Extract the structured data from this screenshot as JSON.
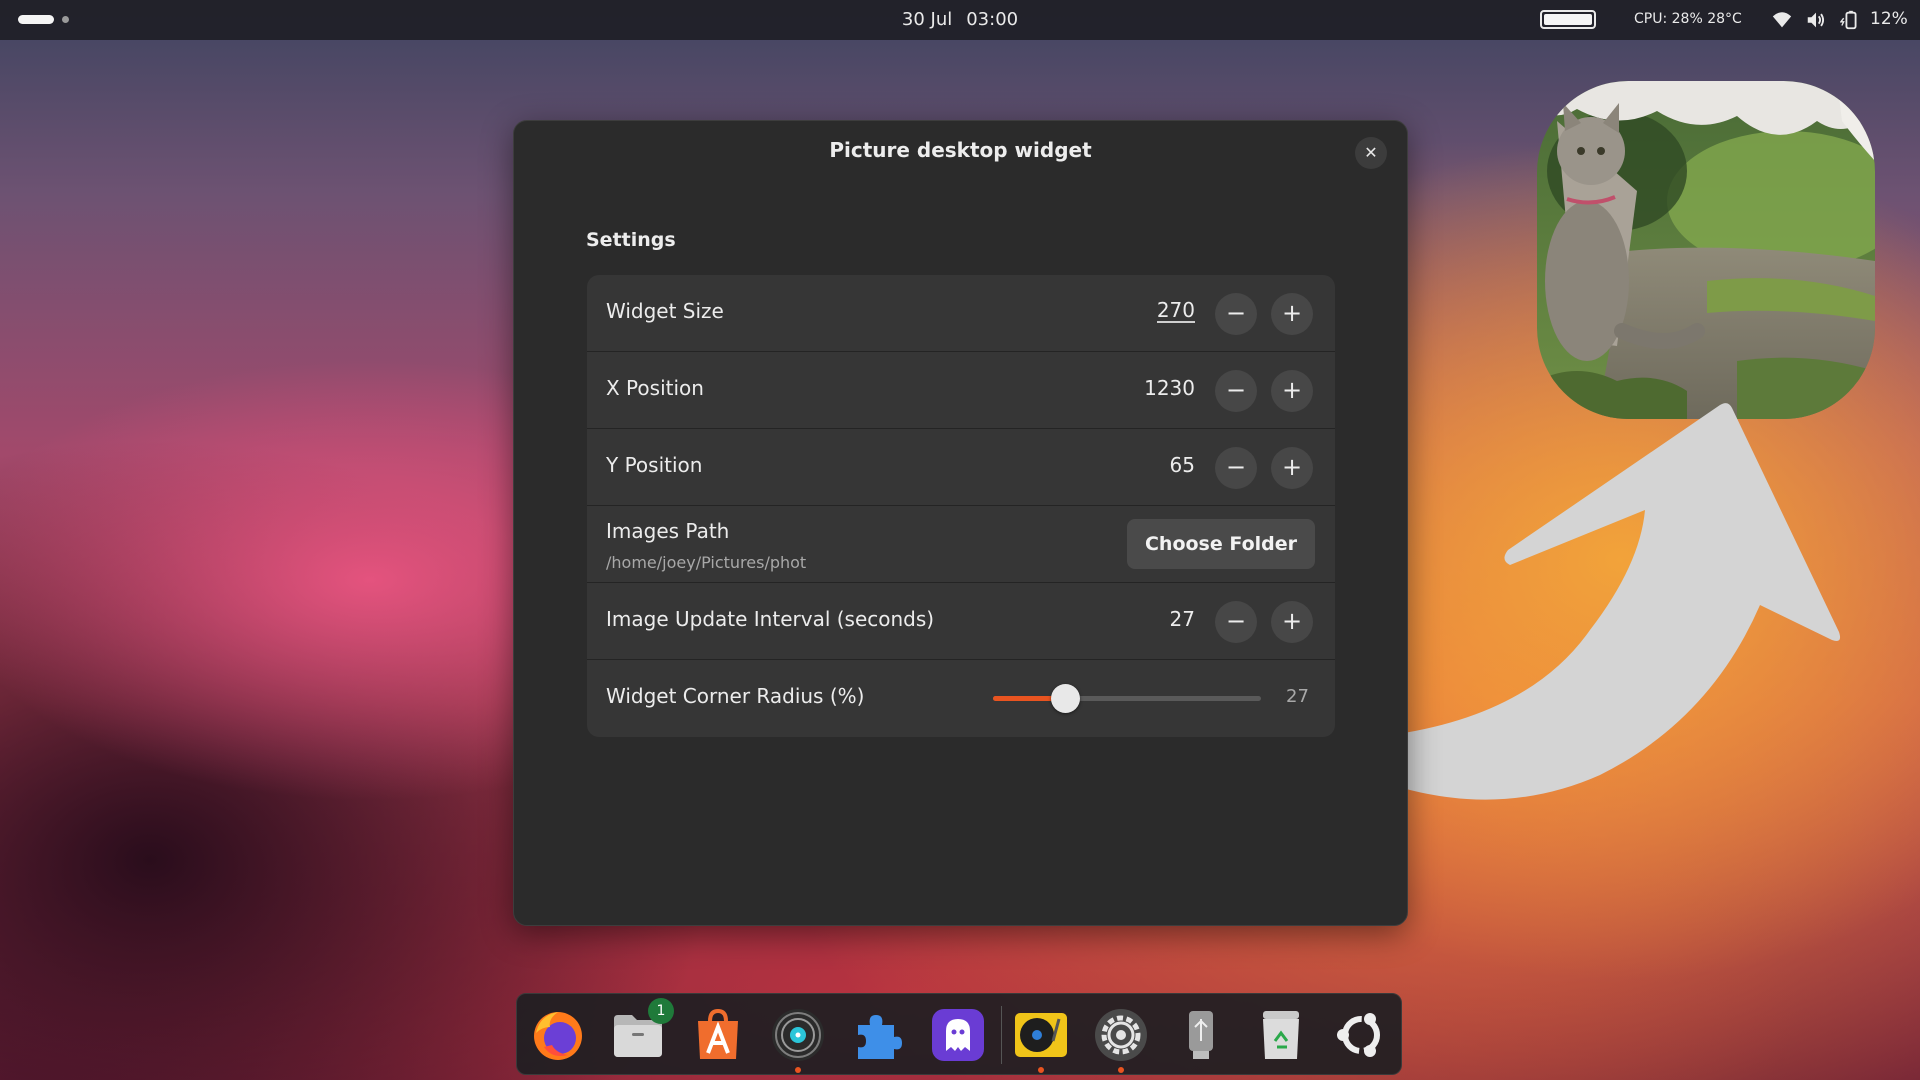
{
  "topbar": {
    "date": "30 Jul",
    "time": "03:00",
    "cpu": "CPU: 28% 28°C",
    "battery_percent": "12%"
  },
  "dialog": {
    "title": "Picture desktop widget",
    "section_title": "Settings",
    "rows": [
      {
        "label": "Widget Size",
        "value": "270"
      },
      {
        "label": "X Position",
        "value": "1230"
      },
      {
        "label": "Y Position",
        "value": "65"
      },
      {
        "label": "Images Path",
        "sublabel": "/home/joey/Pictures/phot",
        "button": "Choose Folder"
      },
      {
        "label": "Image Update Interval (seconds)",
        "value": "27"
      },
      {
        "label": "Widget Corner Radius (%)",
        "value": "27",
        "slider_fraction": 0.27
      }
    ]
  },
  "dock": {
    "items": [
      {
        "name": "Firefox",
        "icon": "firefox-icon"
      },
      {
        "name": "Files",
        "icon": "files-icon",
        "badge": "1"
      },
      {
        "name": "App Center",
        "icon": "app-center-icon"
      },
      {
        "name": "Rhythmbox",
        "icon": "rhythmbox-icon"
      },
      {
        "name": "Extension Manager",
        "icon": "puzzle-icon"
      },
      {
        "name": "Ghost App",
        "icon": "ghost-icon"
      },
      {
        "name": "Music Player",
        "icon": "turntable-icon"
      },
      {
        "name": "Settings",
        "icon": "gear-icon"
      },
      {
        "name": "USB Drive",
        "icon": "usb-drive-icon"
      },
      {
        "name": "Trash",
        "icon": "trash-icon"
      },
      {
        "name": "Show Apps",
        "icon": "ubuntu-logo-icon"
      }
    ]
  },
  "colors": {
    "accent": "#e95420",
    "dialog_bg": "#2b2b2b",
    "row_bg": "#363636"
  }
}
